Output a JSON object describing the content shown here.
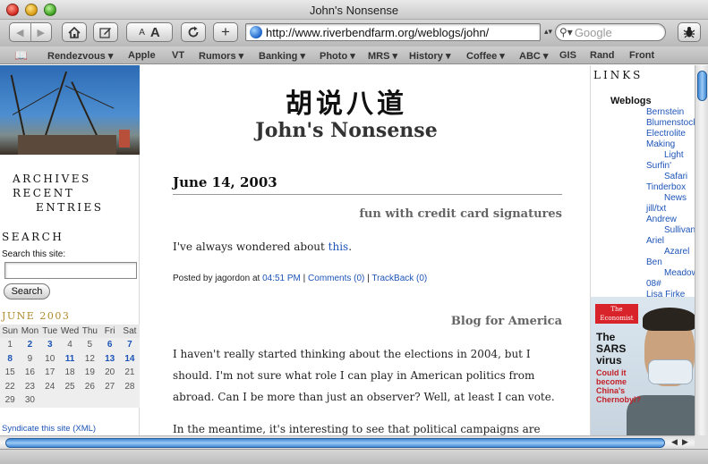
{
  "window": {
    "title": "John's Nonsense"
  },
  "toolbar": {
    "back_icon": "back-arrow-icon",
    "forward_icon": "forward-arrow-icon",
    "home_icon": "home-icon",
    "edit_icon": "pencil-icon",
    "font_small": "A",
    "font_large": "A",
    "reload_icon": "reload-icon",
    "add_label": "+",
    "url": "http://www.riverbendfarm.org/weblogs/john/",
    "search_placeholder": "Google",
    "bug_icon": "bug-report-icon"
  },
  "bookmarks": [
    "Rendezvous ▾",
    "Apple",
    "VT",
    "Rumors ▾",
    "Banking ▾",
    "Photo ▾",
    "MRS ▾",
    "History ▾",
    "Coffee ▾",
    "ABC ▾",
    "GIS",
    "Rand",
    "Front"
  ],
  "sidebar": {
    "archives": "ARCHIVES",
    "recent": "RECENT",
    "entries": "ENTRIES",
    "search_heading": "SEARCH",
    "search_label": "Search this site:",
    "search_value": "",
    "search_button": "Search",
    "calendar_title": "JUNE 2003",
    "calendar_days": [
      "Sun",
      "Mon",
      "Tue",
      "Wed",
      "Thu",
      "Fri",
      "Sat"
    ],
    "calendar_rows": [
      [
        "1",
        "2",
        "3",
        "4",
        "5",
        "6",
        "7"
      ],
      [
        "8",
        "9",
        "10",
        "11",
        "12",
        "13",
        "14"
      ],
      [
        "15",
        "16",
        "17",
        "18",
        "19",
        "20",
        "21"
      ],
      [
        "22",
        "23",
        "24",
        "25",
        "26",
        "27",
        "28"
      ],
      [
        "29",
        "30",
        "",
        "",
        "",
        "",
        ""
      ]
    ],
    "calendar_linked_days": [
      "2",
      "3",
      "6",
      "7",
      "8",
      "11",
      "13",
      "14"
    ],
    "syndicate": "Syndicate this site (XML)"
  },
  "main": {
    "site_title_cjk": "胡说八道",
    "site_title": "John's Nonsense",
    "date_header": "June 14, 2003",
    "post1": {
      "title": "fun with credit card signatures",
      "text_before": "I've always wondered about ",
      "link": "this",
      "text_after": "."
    },
    "meta": {
      "posted_by": "Posted by jagordon at ",
      "time": "04:51 PM",
      "sep1": " | ",
      "comments": "Comments (0)",
      "sep2": " | ",
      "trackback": "TrackBack (0)"
    },
    "post2": {
      "title": "Blog for America",
      "paragraph1": "I haven't really started thinking about the elections in 2004, but I should. I'm not sure what role I can play in American politics from abroad. Can I be more than just an observer? Well, at least I can vote.",
      "paragraph2": "In the meantime, it's interesting to see that political campaigns are starting"
    }
  },
  "rightbar": {
    "links_heading": "LINKS",
    "weblogs_heading": "Weblogs",
    "blogroll": [
      {
        "text": "Bernstein",
        "indent": false
      },
      {
        "text": "Blumenstock",
        "indent": false
      },
      {
        "text": "Electrolite",
        "indent": false
      },
      {
        "text": "Making",
        "indent": false
      },
      {
        "text": "Light",
        "indent": true
      },
      {
        "text": "Surfin'",
        "indent": false
      },
      {
        "text": "Safari",
        "indent": true
      },
      {
        "text": "Tinderbox",
        "indent": false
      },
      {
        "text": "News",
        "indent": true
      },
      {
        "text": "jill/txt",
        "indent": false
      },
      {
        "text": "Andrew",
        "indent": false
      },
      {
        "text": "Sullivan",
        "indent": true
      },
      {
        "text": "Ariel",
        "indent": false
      },
      {
        "text": "Azarel",
        "indent": true
      },
      {
        "text": "Ben",
        "indent": false
      },
      {
        "text": "Meadows",
        "indent": true
      },
      {
        "text": "08#",
        "indent": false
      },
      {
        "text": "Lisa Firke",
        "indent": false
      }
    ],
    "ad": {
      "logo": "The Economist",
      "headline": "The SARS virus",
      "subhead": "Could it become China's Chernobyl?"
    }
  },
  "colors": {
    "link": "#1d54b8",
    "calendar_title": "#b08a2c",
    "scroll_thumb": "#3f87d6"
  }
}
